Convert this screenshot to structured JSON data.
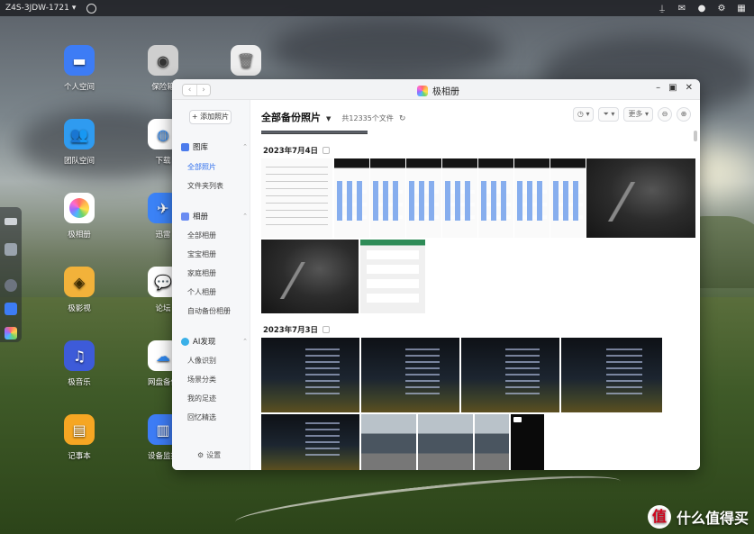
{
  "topbar": {
    "device_name": "Z4S-3JDW-1721",
    "right_icons": [
      "pin-icon",
      "mail-icon",
      "user-icon",
      "gear-icon",
      "grid-icon"
    ]
  },
  "desktop_icons": [
    {
      "label": "个人空间",
      "icon": "folder-icon",
      "color": "#3d7cf5"
    },
    {
      "label": "保险箱",
      "icon": "safe-icon",
      "color": "#cfcfcf"
    },
    {
      "label": "",
      "icon": "trash-icon",
      "color": "#eeeeee"
    },
    {
      "label": "团队空间",
      "icon": "team-folder-icon",
      "color": "#2f9bf0"
    },
    {
      "label": "下载",
      "icon": "download-icon",
      "color": "#ffffff"
    },
    {
      "label": "极相册",
      "icon": "photos-icon",
      "color": "#ffffff"
    },
    {
      "label": "迅雷",
      "icon": "thunder-icon",
      "color": "#3b82f6"
    },
    {
      "label": "极影视",
      "icon": "video-icon",
      "color": "#f2b23a"
    },
    {
      "label": "论坛",
      "icon": "forum-icon",
      "color": "#ffffff"
    },
    {
      "label": "极音乐",
      "icon": "music-icon",
      "color": "#3d5bd9"
    },
    {
      "label": "网盘备份",
      "icon": "cloud-backup-icon",
      "color": "#2f86ec"
    },
    {
      "label": "记事本",
      "icon": "notes-icon",
      "color": "#f6a623"
    },
    {
      "label": "设备监控",
      "icon": "monitor-icon",
      "color": "#3d7cf5"
    }
  ],
  "window": {
    "title": "极相册",
    "controls": [
      "minimize-icon",
      "maximize-icon",
      "close-icon"
    ],
    "sidebar": {
      "add_button": "+ 添加照片",
      "library_section": "图库",
      "library_items": [
        "全部照片",
        "文件夹列表"
      ],
      "album_section": "相册",
      "album_items": [
        "全部相册",
        "宝宝相册",
        "家庭相册",
        "个人相册",
        "自动备份相册"
      ],
      "ai_section": "AI发现",
      "ai_items": [
        "人像识别",
        "场景分类",
        "我的足迹",
        "回忆精选"
      ],
      "settings": "设置"
    },
    "main": {
      "title": "全部备份照片",
      "count": "共12335个文件",
      "tools": {
        "more": "更多"
      },
      "groups": [
        {
          "date": "2023年7月4日"
        },
        {
          "date": "2023年7月3日"
        }
      ]
    }
  },
  "watermark": {
    "logo_glyph": "值",
    "text": "什么值得买"
  }
}
